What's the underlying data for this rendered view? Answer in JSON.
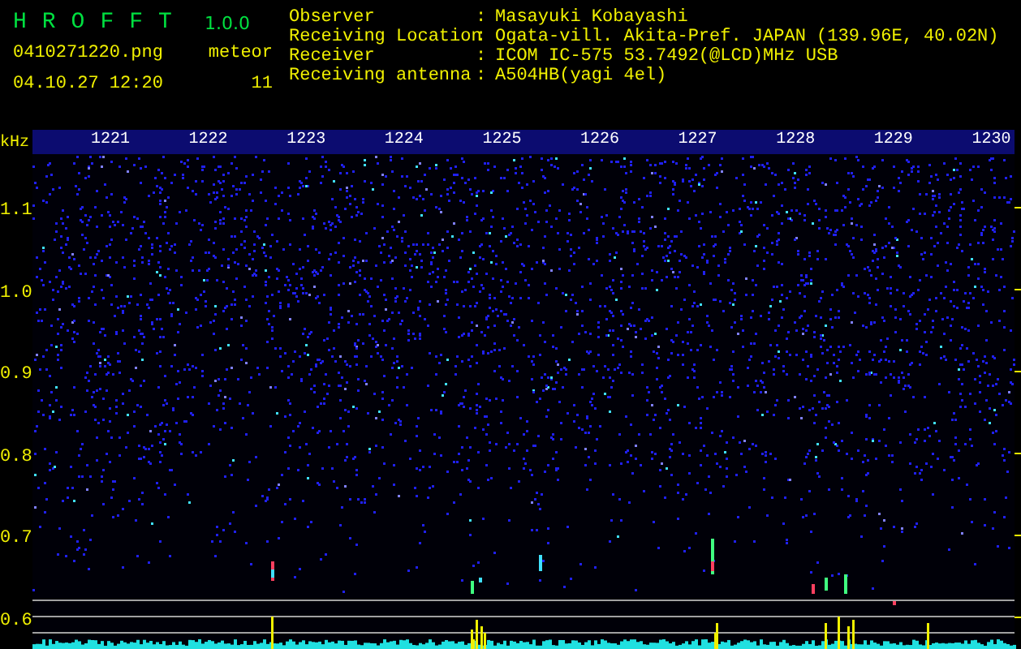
{
  "app": {
    "name": "HROFFT",
    "version": "1.0.0"
  },
  "file": "0410271220.png",
  "datetime": "04.10.27 12:20",
  "meteor": {
    "label": "meteor",
    "count": "11"
  },
  "info": [
    {
      "label": "Observer",
      "separator": ":",
      "value": "Masayuki Kobayashi"
    },
    {
      "label": "Receiving Location",
      "separator": ":",
      "value": "Ogata-vill. Akita-Pref. JAPAN (139.96E, 40.02N)"
    },
    {
      "label": "Receiver",
      "separator": ":",
      "value": "ICOM IC-575 53.7492(@LCD)MHz USB"
    },
    {
      "label": "Receiving antenna",
      "separator": ":",
      "value": "A504HB(yagi 4el)"
    }
  ],
  "spectrogram": {
    "y_unit": "kHz",
    "x_labels": [
      "1221",
      "1222",
      "1223",
      "1224",
      "1225",
      "1226",
      "1227",
      "1228",
      "1229",
      "1230"
    ],
    "y_labels": [
      "1.1",
      "1.0",
      "0.9",
      "0.8",
      "0.7",
      "0.6"
    ]
  }
}
